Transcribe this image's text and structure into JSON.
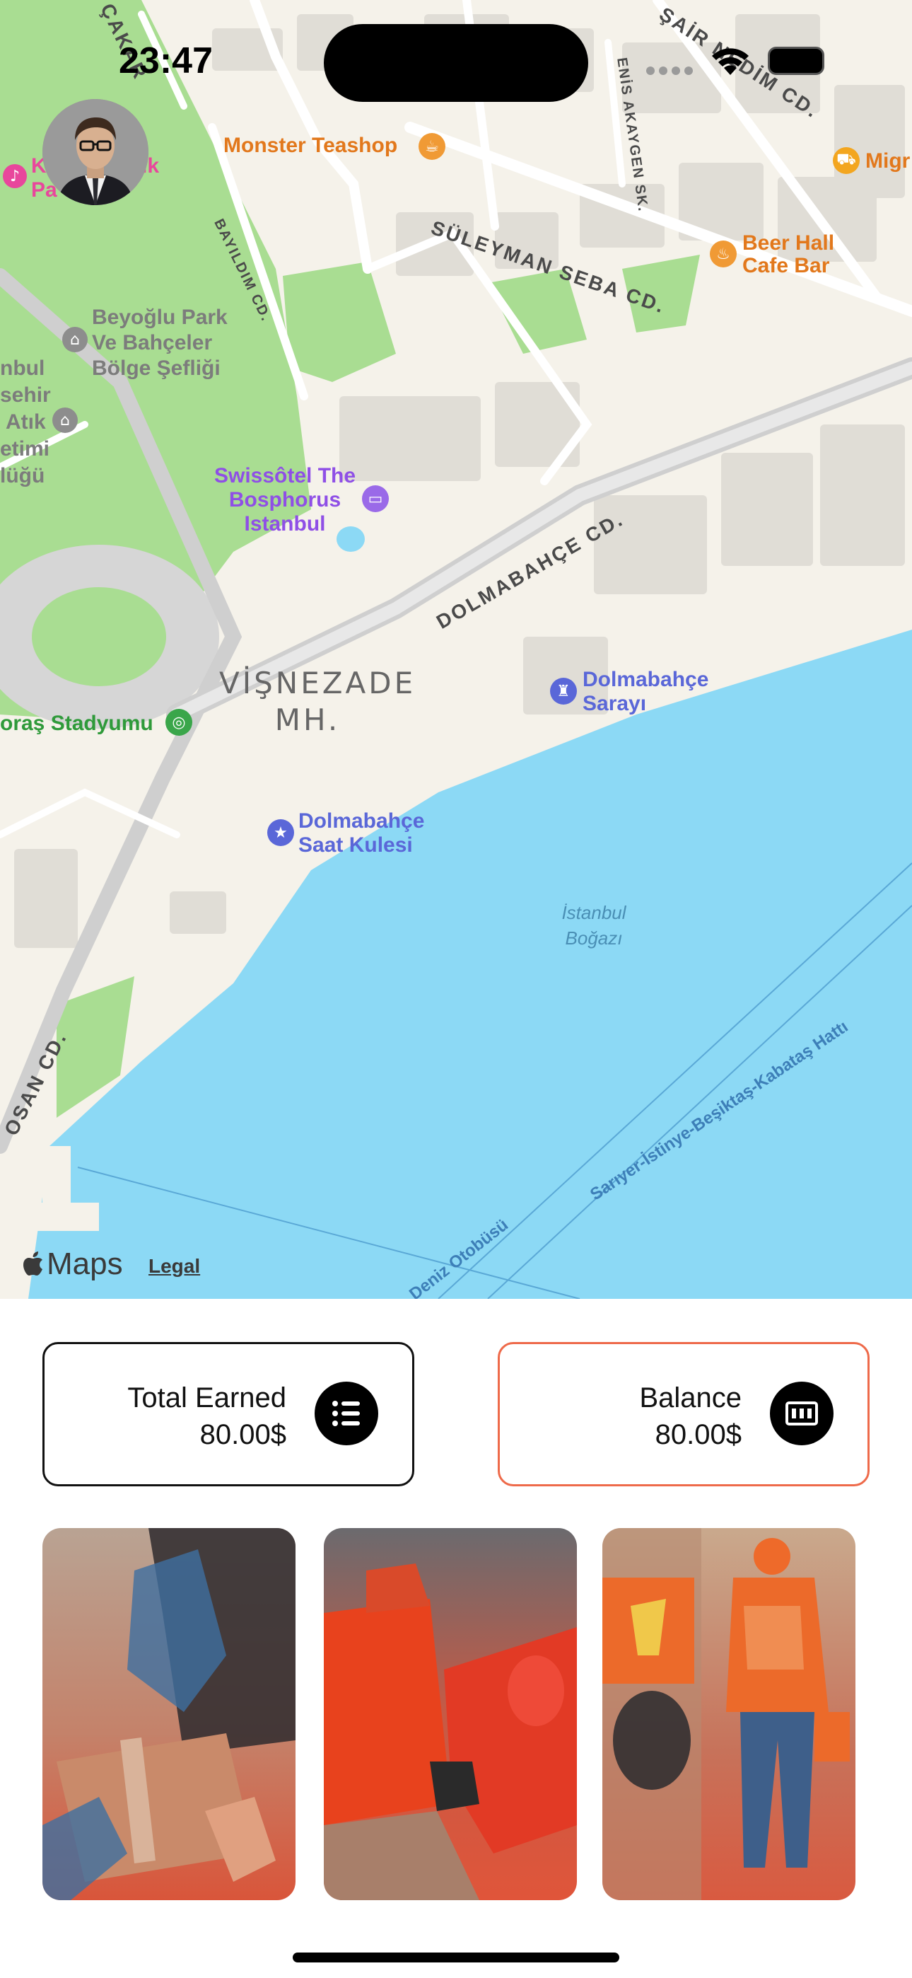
{
  "status_bar": {
    "time": "23:47"
  },
  "map": {
    "labels": {
      "poi_monster_teashop": "Monster Teashop",
      "poi_beer_hall_1": "Beer Hall",
      "poi_beer_hall_2": "Cafe Bar",
      "poi_migros": "Migr",
      "poi_park_1": "K",
      "poi_park_1b": "ik",
      "poi_park_2": "Pa",
      "poi_beyoglu_1": "Beyoğlu Park",
      "poi_beyoglu_2": "Ve Bahçeler",
      "poi_beyoglu_3": "Bölge Şefliği",
      "poi_left_1": "nbul",
      "poi_left_2": "sehir",
      "poi_left_3": "Atık",
      "poi_left_4": "etimi",
      "poi_left_5": "lüğü",
      "poi_swissotel_1": "Swissôtel The",
      "poi_swissotel_2": "Bosphorus",
      "poi_swissotel_3": "Istanbul",
      "district_1": "VİŞNEZADE",
      "district_2": "MH.",
      "poi_stadium": "oraş Stadyumu",
      "poi_palace_1": "Dolmabahçe",
      "poi_palace_2": "Sarayı",
      "poi_clock_1": "Dolmabahçe",
      "poi_clock_2": "Saat Kulesi",
      "water_1": "İstanbul",
      "water_2": "Boğazı",
      "street_suleyman": "SÜLEYMAN SEBA CD.",
      "street_dolmabahce": "DOLMABAHÇE CD.",
      "street_bayildim": "BAYILDIM CD.",
      "street_akaygen": "ENİS AKAYGEN SK.",
      "street_sair": "ŞAİR NEDİM CD.",
      "street_cakar": "ÇAKAR",
      "street_osan": "OSAN CD.",
      "ferry_1": "Sarıyer-İstinye-Beşiktaş-Kabataş Hattı",
      "ferry_2": "Deniz Otobüsü"
    },
    "attribution": {
      "logo": "Maps",
      "legal": "Legal"
    }
  },
  "cards": {
    "earned": {
      "label": "Total Earned",
      "value": "80.00$",
      "icon": "list-icon"
    },
    "balance": {
      "label": "Balance",
      "value": "80.00$",
      "icon": "cash-icon"
    }
  },
  "photos": [
    {
      "name": "package-handoff-photo"
    },
    {
      "name": "delivery-scooter-photo"
    },
    {
      "name": "courier-walking-photo"
    }
  ],
  "colors": {
    "accent": "#ee6a4a",
    "water": "#8cd9f5",
    "park": "#a9dd92",
    "land": "#f5f2ea"
  }
}
